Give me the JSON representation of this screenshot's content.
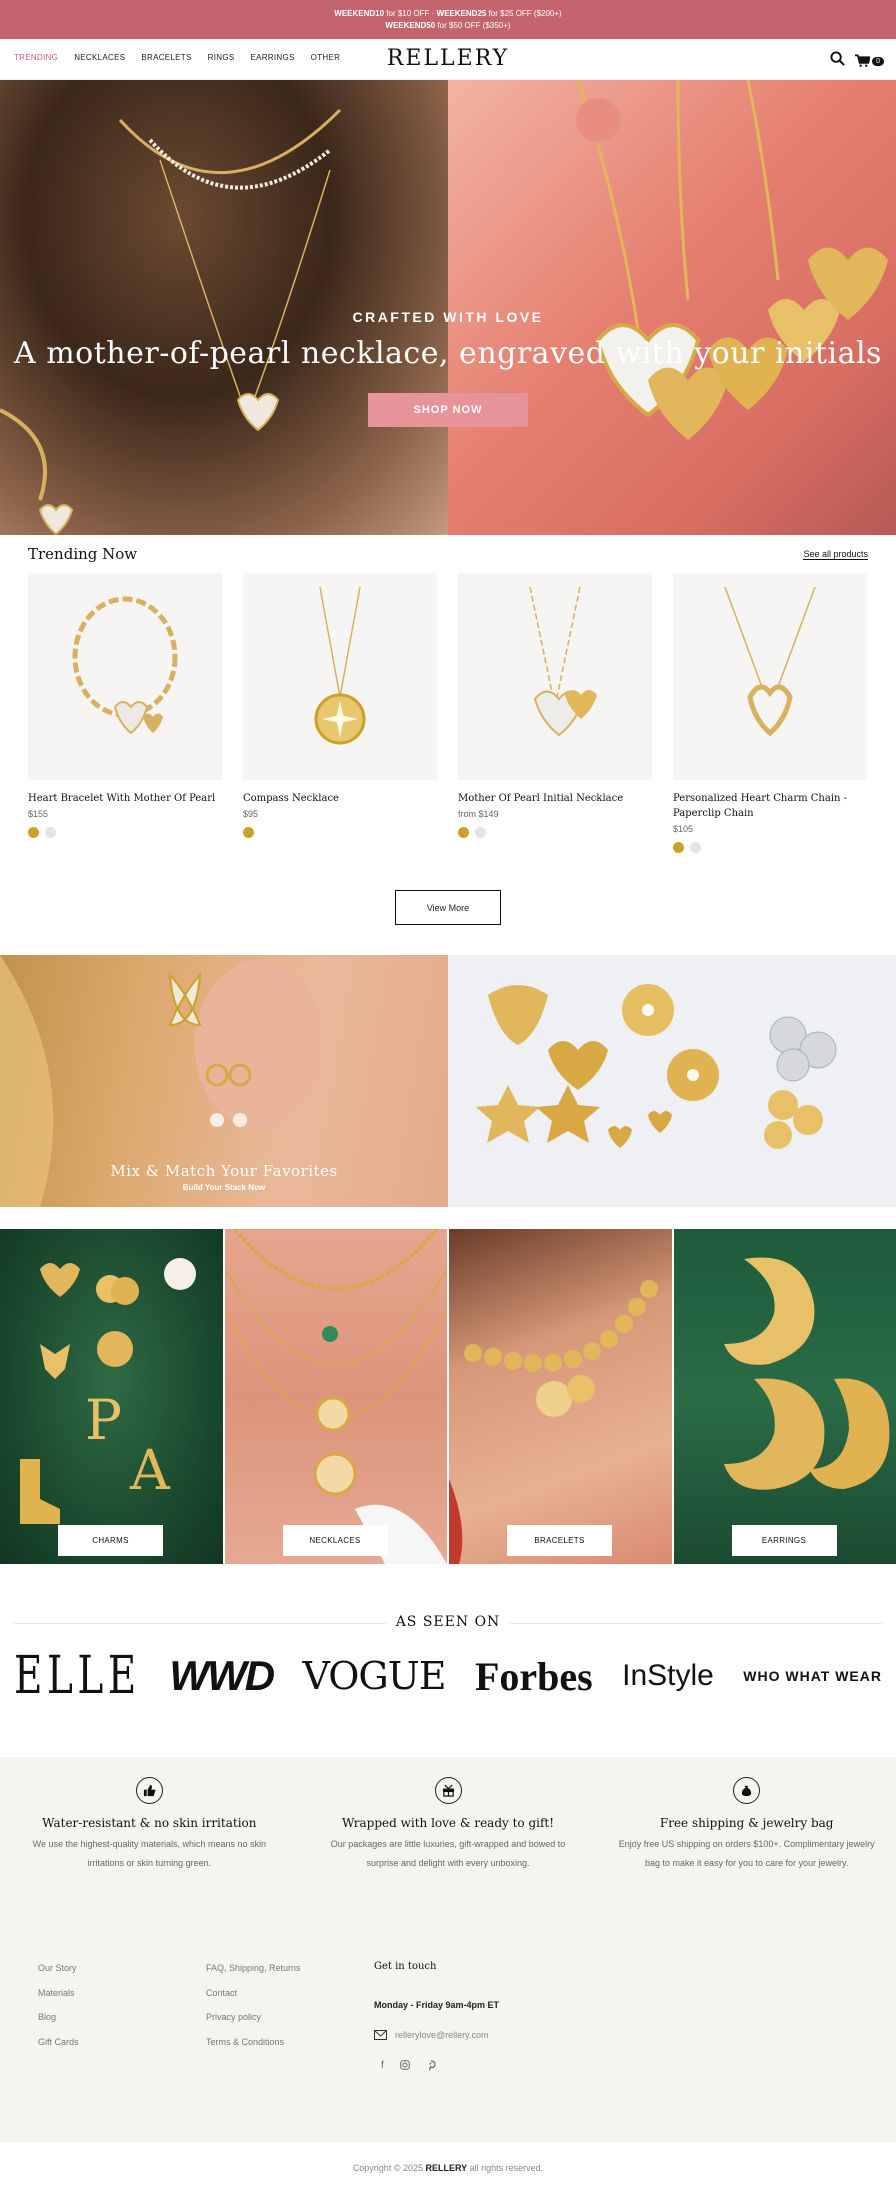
{
  "announcement": {
    "line1_code1": "WEEKEND10",
    "line1_text1": " for $10 OFF · ",
    "line1_code2": "WEEKEND25",
    "line1_text2": " for $25 OFF ($200+)",
    "line2_code": "WEEKEND50",
    "line2_text": " for $50 OFF ($350+)"
  },
  "header": {
    "logo": "RELLERY",
    "nav": [
      "TRENDING",
      "NECKLACES",
      "BRACELETS",
      "RINGS",
      "EARRINGS",
      "OTHER"
    ],
    "cart_count": "0"
  },
  "hero": {
    "kicker": "CRAFTED WITH LOVE",
    "title": "A mother-of-pearl necklace, engraved with your initials",
    "button": "SHOP NOW"
  },
  "trending": {
    "title": "Trending Now",
    "see_all": "See all products",
    "products": [
      {
        "name": "Heart Bracelet With Mother Of Pearl",
        "price": "$155"
      },
      {
        "name": "Compass Necklace",
        "price": "$95"
      },
      {
        "name": "Mother Of Pearl Initial Necklace",
        "price": "from $149"
      },
      {
        "name": "Personalized Heart Charm Chain - Paperclip Chain",
        "price": "$105"
      }
    ],
    "view_more": "View More"
  },
  "mix": {
    "title": "Mix & Match Your Favorites",
    "subtitle": "Build Your Stack Now"
  },
  "categories": [
    "CHARMS",
    "NECKLACES",
    "BRACELETS",
    "EARRINGS"
  ],
  "seen_on": {
    "title": "AS SEEN ON",
    "brands": [
      "ELLE",
      "WWD",
      "VOGUE",
      "Forbes",
      "InStyle",
      "WHO WHAT WEAR"
    ]
  },
  "features": [
    {
      "icon": "thumbs-up-icon",
      "title": "Water-resistant & no skin irritation",
      "text": "We use the highest-quality materials, which means no skin irritations or skin turning green."
    },
    {
      "icon": "gift-icon",
      "title": "Wrapped with love & ready to gift!",
      "text": "Our packages are little luxuries, gift-wrapped and bowed to surprise and delight with every unboxing."
    },
    {
      "icon": "jewelry-bag-icon",
      "title": "Free shipping & jewelry bag",
      "text": "Enjoy free US shipping on orders $100+. Complimentary jewelry bag to make it easy for you to care for your jewelry."
    }
  ],
  "footer": {
    "col1": [
      "Our Story",
      "Materials",
      "Blog",
      "Gift Cards"
    ],
    "col2": [
      "FAQ, Shipping, Returns",
      "Contact",
      "Privacy policy",
      "Terms & Conditions"
    ],
    "get_in_touch": "Get in touch",
    "hours": "Monday - Friday 9am-4pm ET",
    "email": "rellerylove@rellery.com",
    "social": [
      "facebook-icon",
      "instagram-icon",
      "pinterest-icon"
    ]
  },
  "copyright": {
    "prefix": "Copyright © 2025 ",
    "brand": "RELLERY",
    "suffix": " all rights reserved."
  },
  "colors": {
    "announcement_bg": "#c4646e",
    "accent": "#c4646e",
    "hero_button": "#e6939a",
    "gold_swatch": "#c9a227",
    "silver_swatch": "#e4e4e4"
  }
}
